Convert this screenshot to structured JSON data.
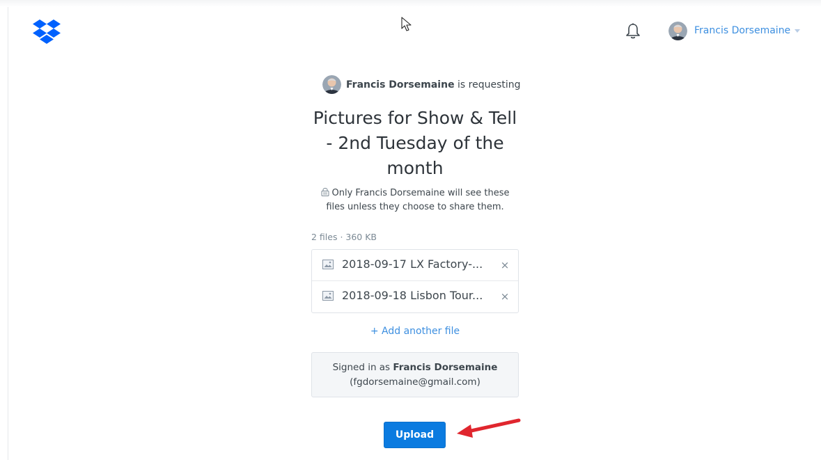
{
  "header": {
    "user_name": "Francis Dorsemaine"
  },
  "request": {
    "requester_name": "Francis Dorsemaine",
    "requesting_text": " is requesting",
    "title_line1": "Pictures for Show & Tell",
    "title_line2": "- 2nd Tuesday of the",
    "title_line3": "month",
    "privacy_line1": "Only Francis Dorsemaine will see these",
    "privacy_line2": "files unless they choose to share them."
  },
  "files": {
    "count_label": "2 files · 360 KB",
    "items": [
      {
        "name": "2018-09-17 LX Factory-...",
        "remove_label": "×"
      },
      {
        "name": "2018-09-18 Lisbon Tour...",
        "remove_label": "×"
      }
    ],
    "add_label": "+ Add another file"
  },
  "signed_in": {
    "prefix": "Signed in as ",
    "name": "Francis Dorsemaine",
    "email": "(fgdorsemaine@gmail.com)"
  },
  "upload_label": "Upload",
  "colors": {
    "accent": "#0b7be0",
    "link": "#3d8fe0",
    "annotation_arrow": "#e0262e"
  },
  "icons": {
    "logo": "dropbox-logo",
    "notifications": "bell-icon",
    "privacy": "lock-icon",
    "file": "image-file-icon",
    "remove": "close-icon"
  }
}
